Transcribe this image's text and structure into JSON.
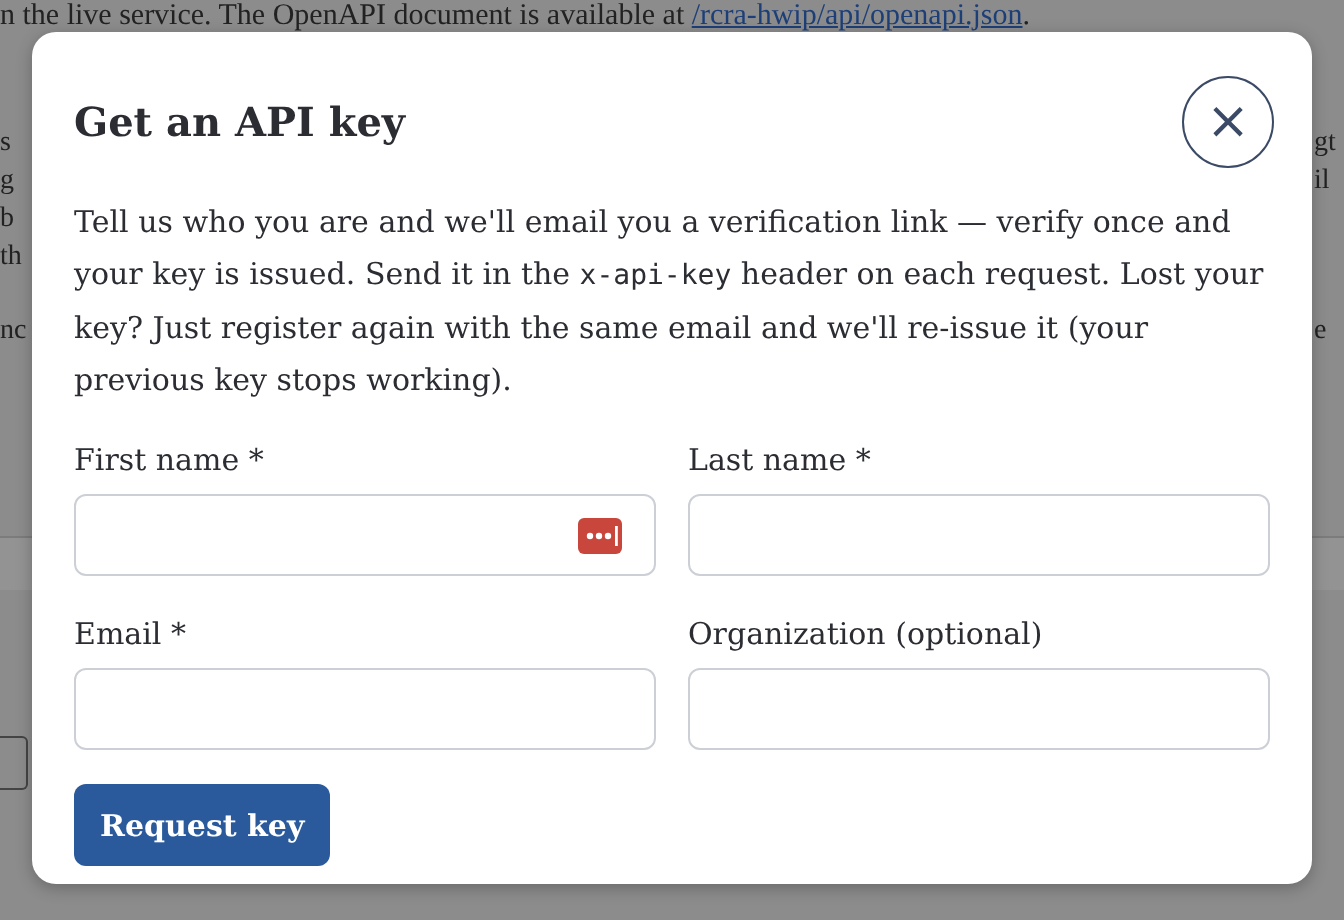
{
  "background": {
    "line_text": "n the live service. The OpenAPI document is available at ",
    "line_link": "/rcra-hwip/api/openapi.json",
    "line_end": ".",
    "left_fragments": [
      "s",
      "g",
      "b",
      "th",
      "nc"
    ],
    "right_fragments": [
      "gt",
      "il",
      "e"
    ]
  },
  "dialog": {
    "title": "Get an API key",
    "close_label": "×",
    "intro": [
      {
        "kind": "text",
        "text": "Tell us who you are and we'll email you a verification link — verify once and your key is issued. Send it in the "
      },
      {
        "kind": "code",
        "text": "x-api-key"
      },
      {
        "kind": "text",
        "text": " header on each request. Lost your key? Just register again with the same email and we'll re-issue it (your previous key stops working)."
      }
    ],
    "fields": [
      {
        "label": "First name *",
        "autofill_icon": true
      },
      {
        "label": "Last name *",
        "autofill_icon": false
      },
      {
        "label": "Email *",
        "autofill_icon": false
      },
      {
        "label": "Organization (optional)",
        "autofill_icon": false
      }
    ],
    "submit": "Request key"
  }
}
